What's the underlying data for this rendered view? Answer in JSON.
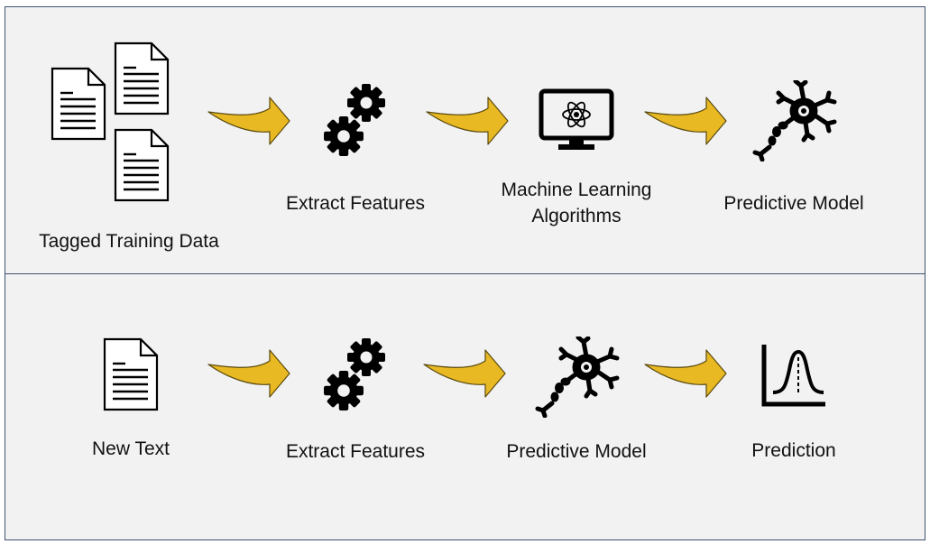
{
  "colors": {
    "panel_bg": "#f2f2f2",
    "panel_border": "#3f5270",
    "arrow_fill": "#e8b923",
    "arrow_stroke": "#5a4a10",
    "icon": "#000000"
  },
  "training_pipeline": {
    "steps": [
      {
        "label": "Tagged Training Data",
        "icon": "documents-icon"
      },
      {
        "label": "Extract Features",
        "icon": "gears-icon"
      },
      {
        "label_lines": [
          "Machine Learning",
          "Algorithms"
        ],
        "icon": "monitor-atom-icon"
      },
      {
        "label": "Predictive Model",
        "icon": "neuron-icon"
      }
    ]
  },
  "prediction_pipeline": {
    "steps": [
      {
        "label": "New Text",
        "icon": "document-icon"
      },
      {
        "label": "Extract Features",
        "icon": "gears-icon"
      },
      {
        "label": "Predictive Model",
        "icon": "neuron-icon"
      },
      {
        "label": "Prediction",
        "icon": "bell-curve-chart-icon"
      }
    ]
  }
}
